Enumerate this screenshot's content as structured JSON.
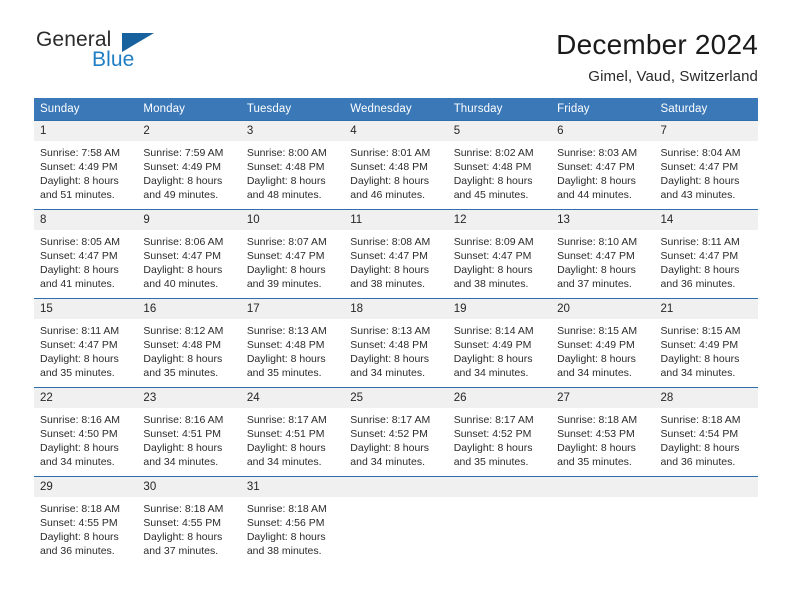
{
  "logo": {
    "word_top": "General",
    "word_bottom": "Blue",
    "triangle_color": "#17619e",
    "blue_color": "#1f7ec4"
  },
  "header": {
    "title": "December 2024",
    "subtitle": "Gimel, Vaud, Switzerland"
  },
  "theme": {
    "header_row_bg": "#3a78b8",
    "row_divider": "#2f6fae",
    "daynum_bg": "#f0f0f0"
  },
  "weekdays": [
    "Sunday",
    "Monday",
    "Tuesday",
    "Wednesday",
    "Thursday",
    "Friday",
    "Saturday"
  ],
  "weeks": [
    [
      {
        "day": "1",
        "sunrise": "Sunrise: 7:58 AM",
        "sunset": "Sunset: 4:49 PM",
        "daylight_line1": "Daylight: 8 hours",
        "daylight_line2": "and 51 minutes."
      },
      {
        "day": "2",
        "sunrise": "Sunrise: 7:59 AM",
        "sunset": "Sunset: 4:49 PM",
        "daylight_line1": "Daylight: 8 hours",
        "daylight_line2": "and 49 minutes."
      },
      {
        "day": "3",
        "sunrise": "Sunrise: 8:00 AM",
        "sunset": "Sunset: 4:48 PM",
        "daylight_line1": "Daylight: 8 hours",
        "daylight_line2": "and 48 minutes."
      },
      {
        "day": "4",
        "sunrise": "Sunrise: 8:01 AM",
        "sunset": "Sunset: 4:48 PM",
        "daylight_line1": "Daylight: 8 hours",
        "daylight_line2": "and 46 minutes."
      },
      {
        "day": "5",
        "sunrise": "Sunrise: 8:02 AM",
        "sunset": "Sunset: 4:48 PM",
        "daylight_line1": "Daylight: 8 hours",
        "daylight_line2": "and 45 minutes."
      },
      {
        "day": "6",
        "sunrise": "Sunrise: 8:03 AM",
        "sunset": "Sunset: 4:47 PM",
        "daylight_line1": "Daylight: 8 hours",
        "daylight_line2": "and 44 minutes."
      },
      {
        "day": "7",
        "sunrise": "Sunrise: 8:04 AM",
        "sunset": "Sunset: 4:47 PM",
        "daylight_line1": "Daylight: 8 hours",
        "daylight_line2": "and 43 minutes."
      }
    ],
    [
      {
        "day": "8",
        "sunrise": "Sunrise: 8:05 AM",
        "sunset": "Sunset: 4:47 PM",
        "daylight_line1": "Daylight: 8 hours",
        "daylight_line2": "and 41 minutes."
      },
      {
        "day": "9",
        "sunrise": "Sunrise: 8:06 AM",
        "sunset": "Sunset: 4:47 PM",
        "daylight_line1": "Daylight: 8 hours",
        "daylight_line2": "and 40 minutes."
      },
      {
        "day": "10",
        "sunrise": "Sunrise: 8:07 AM",
        "sunset": "Sunset: 4:47 PM",
        "daylight_line1": "Daylight: 8 hours",
        "daylight_line2": "and 39 minutes."
      },
      {
        "day": "11",
        "sunrise": "Sunrise: 8:08 AM",
        "sunset": "Sunset: 4:47 PM",
        "daylight_line1": "Daylight: 8 hours",
        "daylight_line2": "and 38 minutes."
      },
      {
        "day": "12",
        "sunrise": "Sunrise: 8:09 AM",
        "sunset": "Sunset: 4:47 PM",
        "daylight_line1": "Daylight: 8 hours",
        "daylight_line2": "and 38 minutes."
      },
      {
        "day": "13",
        "sunrise": "Sunrise: 8:10 AM",
        "sunset": "Sunset: 4:47 PM",
        "daylight_line1": "Daylight: 8 hours",
        "daylight_line2": "and 37 minutes."
      },
      {
        "day": "14",
        "sunrise": "Sunrise: 8:11 AM",
        "sunset": "Sunset: 4:47 PM",
        "daylight_line1": "Daylight: 8 hours",
        "daylight_line2": "and 36 minutes."
      }
    ],
    [
      {
        "day": "15",
        "sunrise": "Sunrise: 8:11 AM",
        "sunset": "Sunset: 4:47 PM",
        "daylight_line1": "Daylight: 8 hours",
        "daylight_line2": "and 35 minutes."
      },
      {
        "day": "16",
        "sunrise": "Sunrise: 8:12 AM",
        "sunset": "Sunset: 4:48 PM",
        "daylight_line1": "Daylight: 8 hours",
        "daylight_line2": "and 35 minutes."
      },
      {
        "day": "17",
        "sunrise": "Sunrise: 8:13 AM",
        "sunset": "Sunset: 4:48 PM",
        "daylight_line1": "Daylight: 8 hours",
        "daylight_line2": "and 35 minutes."
      },
      {
        "day": "18",
        "sunrise": "Sunrise: 8:13 AM",
        "sunset": "Sunset: 4:48 PM",
        "daylight_line1": "Daylight: 8 hours",
        "daylight_line2": "and 34 minutes."
      },
      {
        "day": "19",
        "sunrise": "Sunrise: 8:14 AM",
        "sunset": "Sunset: 4:49 PM",
        "daylight_line1": "Daylight: 8 hours",
        "daylight_line2": "and 34 minutes."
      },
      {
        "day": "20",
        "sunrise": "Sunrise: 8:15 AM",
        "sunset": "Sunset: 4:49 PM",
        "daylight_line1": "Daylight: 8 hours",
        "daylight_line2": "and 34 minutes."
      },
      {
        "day": "21",
        "sunrise": "Sunrise: 8:15 AM",
        "sunset": "Sunset: 4:49 PM",
        "daylight_line1": "Daylight: 8 hours",
        "daylight_line2": "and 34 minutes."
      }
    ],
    [
      {
        "day": "22",
        "sunrise": "Sunrise: 8:16 AM",
        "sunset": "Sunset: 4:50 PM",
        "daylight_line1": "Daylight: 8 hours",
        "daylight_line2": "and 34 minutes."
      },
      {
        "day": "23",
        "sunrise": "Sunrise: 8:16 AM",
        "sunset": "Sunset: 4:51 PM",
        "daylight_line1": "Daylight: 8 hours",
        "daylight_line2": "and 34 minutes."
      },
      {
        "day": "24",
        "sunrise": "Sunrise: 8:17 AM",
        "sunset": "Sunset: 4:51 PM",
        "daylight_line1": "Daylight: 8 hours",
        "daylight_line2": "and 34 minutes."
      },
      {
        "day": "25",
        "sunrise": "Sunrise: 8:17 AM",
        "sunset": "Sunset: 4:52 PM",
        "daylight_line1": "Daylight: 8 hours",
        "daylight_line2": "and 34 minutes."
      },
      {
        "day": "26",
        "sunrise": "Sunrise: 8:17 AM",
        "sunset": "Sunset: 4:52 PM",
        "daylight_line1": "Daylight: 8 hours",
        "daylight_line2": "and 35 minutes."
      },
      {
        "day": "27",
        "sunrise": "Sunrise: 8:18 AM",
        "sunset": "Sunset: 4:53 PM",
        "daylight_line1": "Daylight: 8 hours",
        "daylight_line2": "and 35 minutes."
      },
      {
        "day": "28",
        "sunrise": "Sunrise: 8:18 AM",
        "sunset": "Sunset: 4:54 PM",
        "daylight_line1": "Daylight: 8 hours",
        "daylight_line2": "and 36 minutes."
      }
    ],
    [
      {
        "day": "29",
        "sunrise": "Sunrise: 8:18 AM",
        "sunset": "Sunset: 4:55 PM",
        "daylight_line1": "Daylight: 8 hours",
        "daylight_line2": "and 36 minutes."
      },
      {
        "day": "30",
        "sunrise": "Sunrise: 8:18 AM",
        "sunset": "Sunset: 4:55 PM",
        "daylight_line1": "Daylight: 8 hours",
        "daylight_line2": "and 37 minutes."
      },
      {
        "day": "31",
        "sunrise": "Sunrise: 8:18 AM",
        "sunset": "Sunset: 4:56 PM",
        "daylight_line1": "Daylight: 8 hours",
        "daylight_line2": "and 38 minutes."
      },
      {
        "day": "",
        "sunrise": "",
        "sunset": "",
        "daylight_line1": "",
        "daylight_line2": ""
      },
      {
        "day": "",
        "sunrise": "",
        "sunset": "",
        "daylight_line1": "",
        "daylight_line2": ""
      },
      {
        "day": "",
        "sunrise": "",
        "sunset": "",
        "daylight_line1": "",
        "daylight_line2": ""
      },
      {
        "day": "",
        "sunrise": "",
        "sunset": "",
        "daylight_line1": "",
        "daylight_line2": ""
      }
    ]
  ]
}
